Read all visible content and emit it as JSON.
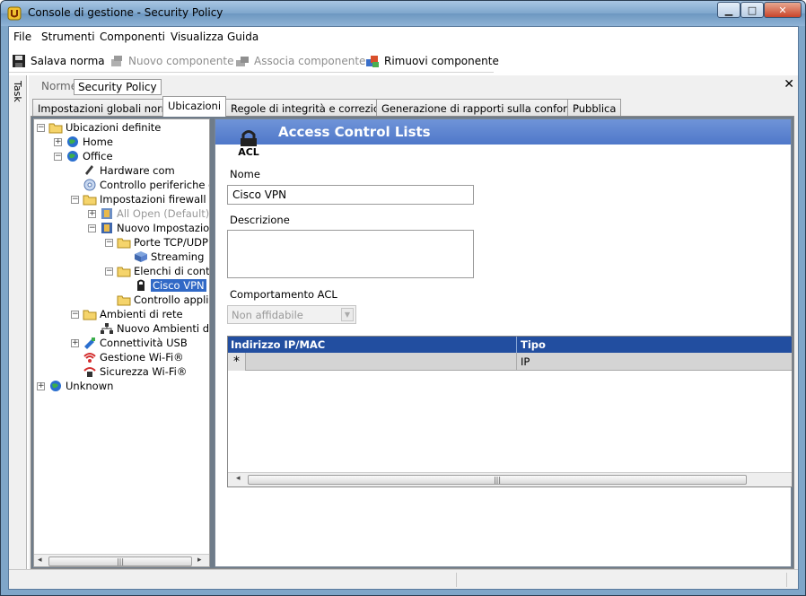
{
  "window": {
    "title": "Console di gestione  - Security Policy"
  },
  "menu": [
    "File",
    "Strumenti",
    "Componenti",
    "Visualizza",
    "Guida"
  ],
  "toolbar": {
    "save": "Salava norma",
    "new_component": "Nuovo componente",
    "associate_component": "Associa componente",
    "remove_component": "Rimuovi componente"
  },
  "task_label": "Task",
  "top_tabs": {
    "norme": "Norme",
    "security_policy": "Security Policy"
  },
  "tabs": [
    "Impostazioni globali norme",
    "Ubicazioni",
    "Regole di integrità e correzione",
    "Generazione di rapporti sulla conformità",
    "Pubblica"
  ],
  "tree": [
    {
      "label": "Ubicazioni definite"
    },
    {
      "label": "Home"
    },
    {
      "label": "Office"
    },
    {
      "label": "Hardware com"
    },
    {
      "label": "Controllo periferiche di"
    },
    {
      "label": "Impostazioni firewall"
    },
    {
      "label": "All Open (Default)"
    },
    {
      "label": "Nuovo Impostazioni"
    },
    {
      "label": "Porte TCP/UDP"
    },
    {
      "label": "Streaming"
    },
    {
      "label": "Elenchi di contr"
    },
    {
      "label": "Cisco VPN"
    },
    {
      "label": "Controllo applic"
    },
    {
      "label": "Ambienti di rete"
    },
    {
      "label": "Nuovo Ambienti di r"
    },
    {
      "label": "Connettività USB"
    },
    {
      "label": "Gestione Wi-Fi®"
    },
    {
      "label": "Sicurezza Wi-Fi®"
    },
    {
      "label": "Unknown"
    }
  ],
  "detail": {
    "banner_title": "Access Control Lists",
    "icon_text": "ACL",
    "name_label": "Nome",
    "name_value": "Cisco VPN",
    "description_label": "Descrizione",
    "description_value": "",
    "behavior_label": "Comportamento ACL",
    "behavior_value": "Non affidabile",
    "grid": {
      "columns": [
        "Indirizzo IP/MAC",
        "Tipo"
      ],
      "new_row_marker": "*",
      "rows": [
        {
          "address": "",
          "type": "IP"
        }
      ]
    }
  },
  "colors": {
    "banner": "#5a82ce",
    "grid_header": "#224ea0",
    "selection": "#3169c6"
  }
}
